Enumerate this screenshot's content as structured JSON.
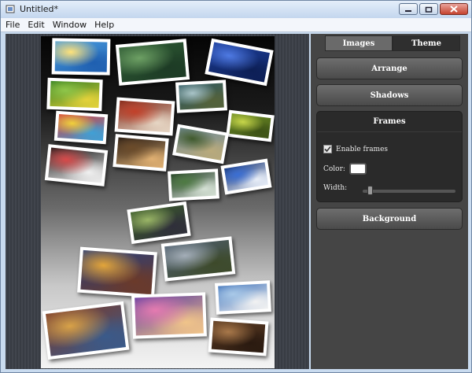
{
  "window": {
    "title": "Untitled*"
  },
  "menu": {
    "items": [
      "File",
      "Edit",
      "Window",
      "Help"
    ]
  },
  "canvas": {
    "photos": [
      {
        "subject": "swimmers-photo",
        "colors": [
          "#4b9fe0",
          "#ffe27a",
          "#1f5fb0"
        ]
      },
      {
        "subject": "green-valley-photo",
        "colors": [
          "#2e5a34",
          "#6da064",
          "#1d3b25"
        ]
      },
      {
        "subject": "blue-lake-photo",
        "colors": [
          "#1c3e9a",
          "#4f7ae3",
          "#0d1f55"
        ]
      },
      {
        "subject": "green-sports-photo",
        "colors": [
          "#2d7a1e",
          "#8fc64a",
          "#e4d23a"
        ]
      },
      {
        "subject": "running-track-photo",
        "colors": [
          "#7a2818",
          "#c2412a",
          "#e6d6c4"
        ]
      },
      {
        "subject": "river-landscape-photo",
        "colors": [
          "#2f5a63",
          "#a9c4c8",
          "#55623a"
        ]
      },
      {
        "subject": "colored-pencils-photo",
        "colors": [
          "#d93a3a",
          "#f0d03b",
          "#3fa0d6"
        ]
      },
      {
        "subject": "green-leaves-photo",
        "colors": [
          "#6d8c24",
          "#c7d64a",
          "#3d5216"
        ]
      },
      {
        "subject": "valley-road-photo",
        "colors": [
          "#6f8a95",
          "#405a2c",
          "#b9aa7c"
        ]
      },
      {
        "subject": "dancers-photo",
        "colors": [
          "#111111",
          "#d84a4a",
          "#f0f0f0"
        ]
      },
      {
        "subject": "cave-light-photo",
        "colors": [
          "#1d1410",
          "#6b4b2a",
          "#e0b072"
        ]
      },
      {
        "subject": "waterfall-photo",
        "colors": [
          "#1f3a22",
          "#4e7a43",
          "#d4e0d4"
        ]
      },
      {
        "subject": "blue-harbor-photo",
        "colors": [
          "#0f2f73",
          "#3a6ed4",
          "#e8eef8"
        ]
      },
      {
        "subject": "bird-photo",
        "colors": [
          "#3a5a2a",
          "#9ab567",
          "#2f2f3a"
        ]
      },
      {
        "subject": "temple-sunset-photo",
        "colors": [
          "#2a3f7a",
          "#e3a53a",
          "#6b3a2a"
        ]
      },
      {
        "subject": "lake-hills-photo",
        "colors": [
          "#4f5f70",
          "#a4aeb8",
          "#3d4a2a"
        ]
      },
      {
        "subject": "pagoda-dusk-photo",
        "colors": [
          "#5a3aa0",
          "#e57bb0",
          "#f0c48a"
        ]
      },
      {
        "subject": "seaside-houses-photo",
        "colors": [
          "#3b6fb8",
          "#a9c9e8",
          "#f2f2f2"
        ]
      },
      {
        "subject": "costume-parade-photo",
        "colors": [
          "#7a3a2a",
          "#d8a248",
          "#3a5a8a"
        ]
      },
      {
        "subject": "crowd-photo",
        "colors": [
          "#5a3a22",
          "#a8784a",
          "#2a1a10"
        ]
      }
    ]
  },
  "panel": {
    "tabs": [
      {
        "label": "Images",
        "active": false
      },
      {
        "label": "Theme",
        "active": true
      }
    ],
    "sections": {
      "arrange": "Arrange",
      "shadows": "Shadows",
      "background": "Background"
    },
    "frames": {
      "title": "Frames",
      "enable_label": "Enable frames",
      "enable_checked": true,
      "color_label": "Color:",
      "color_value": "#ffffff",
      "width_label": "Width:",
      "width_level": 0.05
    }
  }
}
